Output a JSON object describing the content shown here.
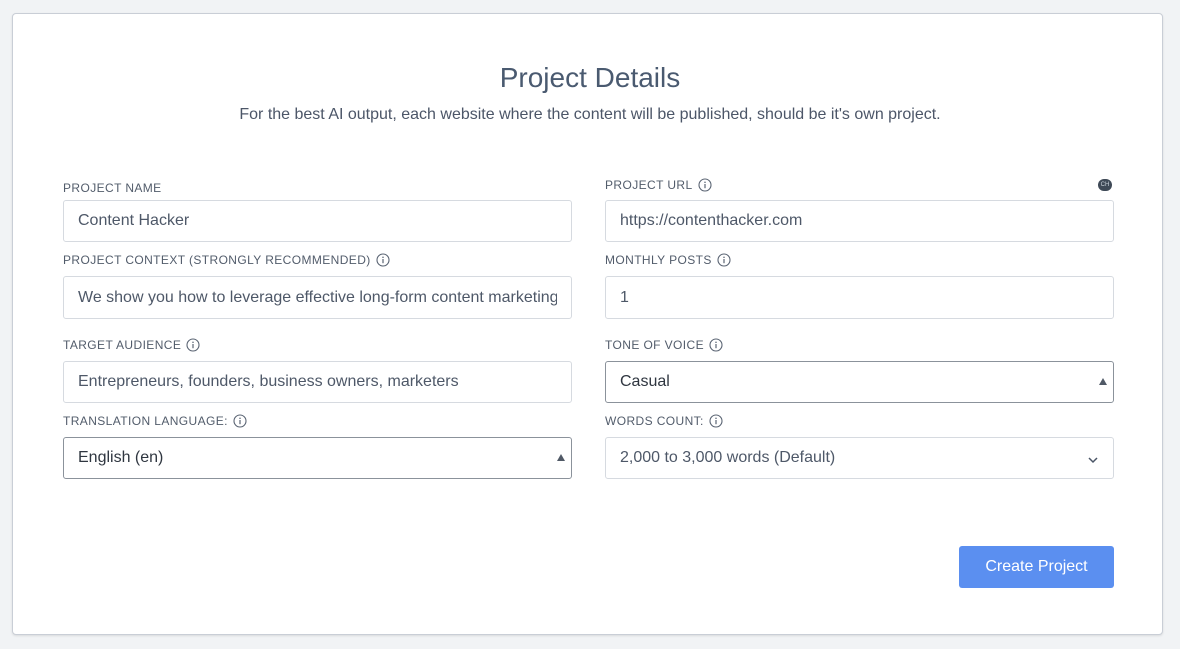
{
  "header": {
    "title": "Project Details",
    "subtitle": "For the best AI output, each website where the content will be published, should be it's own project."
  },
  "fields": {
    "project_name": {
      "label": "PROJECT NAME",
      "value": "Content Hacker"
    },
    "project_url": {
      "label": "PROJECT URL",
      "value": "https://contenthacker.com"
    },
    "project_context": {
      "label": "PROJECT CONTEXT (STRONGLY RECOMMENDED)",
      "value": "We show you how to leverage effective long-form content marketing"
    },
    "monthly_posts": {
      "label": "MONTHLY POSTS",
      "value": "1"
    },
    "target_audience": {
      "label": "TARGET AUDIENCE",
      "value": "Entrepreneurs, founders, business owners, marketers"
    },
    "tone_of_voice": {
      "label": "TONE OF VOICE",
      "value": "Casual"
    },
    "translation_language": {
      "label": "TRANSLATION LANGUAGE:",
      "value": "English (en)"
    },
    "words_count": {
      "label": "WORDS COUNT:",
      "value": "2,000 to 3,000 words (Default)"
    }
  },
  "extension_badge": {
    "text": "CH"
  },
  "actions": {
    "create_label": "Create Project"
  },
  "colors": {
    "accent": "#5b8ff0",
    "text": "#4a5566",
    "border": "#d6dae0"
  },
  "icons": [
    "info-icon",
    "chevron-down-icon",
    "caret-up-icon"
  ]
}
